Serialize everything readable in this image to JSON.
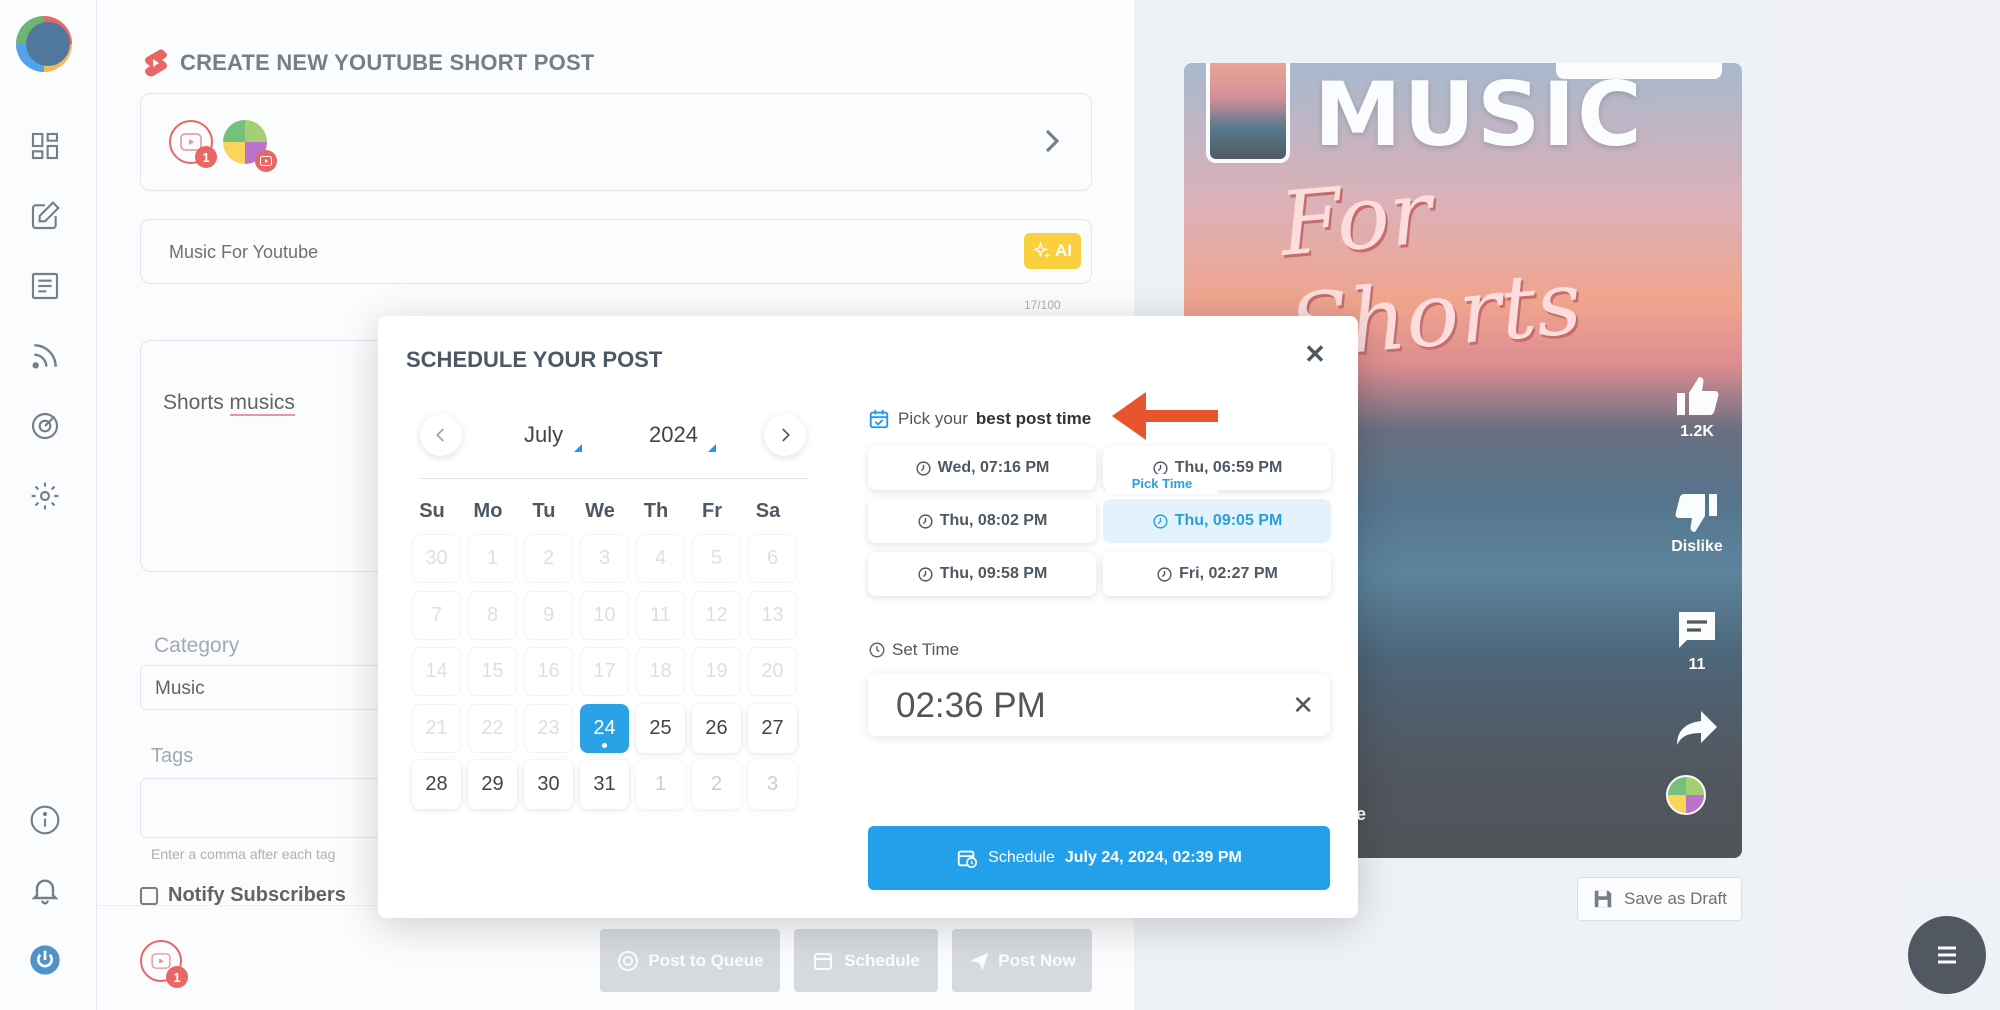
{
  "page": {
    "title": "CREATE NEW YOUTUBE SHORT POST",
    "accent_color": "#22a0ea",
    "brand_red": "#e53935"
  },
  "account_selector": {
    "badge_count": "1"
  },
  "title_field": {
    "value": "Music For Youtube",
    "ai_label": "AI",
    "char_count": "17/100"
  },
  "description": {
    "word_plain": "Shorts",
    "word_misspelled": "musics"
  },
  "category": {
    "label": "Category",
    "value": "Music"
  },
  "tags": {
    "label": "Tags",
    "hint": "Enter a comma after each tag"
  },
  "notify": {
    "label": "Notify Subscribers"
  },
  "bottom_bar": {
    "badge_count": "1",
    "post_to_queue": "Post to Queue",
    "schedule": "Schedule",
    "post_now": "Post Now"
  },
  "preview": {
    "title_line1": "MUSIC",
    "title_line2": "For Shorts",
    "likes": "1.2K",
    "dislike": "Dislike",
    "comments": "11",
    "caption_fragment": "e"
  },
  "save_draft": "Save as Draft",
  "modal": {
    "title": "SCHEDULE YOUR POST",
    "month": "July",
    "year": "2024",
    "weekdays": [
      "Su",
      "Mo",
      "Tu",
      "We",
      "Th",
      "Fr",
      "Sa"
    ],
    "weeks": [
      [
        "30",
        "1",
        "2",
        "3",
        "4",
        "5",
        "6"
      ],
      [
        "7",
        "8",
        "9",
        "10",
        "11",
        "12",
        "13"
      ],
      [
        "14",
        "15",
        "16",
        "17",
        "18",
        "19",
        "20"
      ],
      [
        "21",
        "22",
        "23",
        "24",
        "25",
        "26",
        "27"
      ],
      [
        "28",
        "29",
        "30",
        "31",
        "1",
        "2",
        "3"
      ]
    ],
    "selected_day": "24",
    "pick_prefix": "Pick your",
    "pick_bold": "best post time",
    "best_times": [
      "Wed, 07:16 PM",
      "Thu, 06:59 PM",
      "Thu, 08:02 PM",
      "Thu, 09:05 PM",
      "Thu, 09:58 PM",
      "Fri, 02:27 PM"
    ],
    "highlighted_time": "Thu, 09:05 PM",
    "tooltip": "Pick Time",
    "set_time_label": "Set Time",
    "time_value": "02:36 PM",
    "schedule_label": "Schedule",
    "schedule_datetime": "July 24, 2024, 02:39 PM"
  }
}
